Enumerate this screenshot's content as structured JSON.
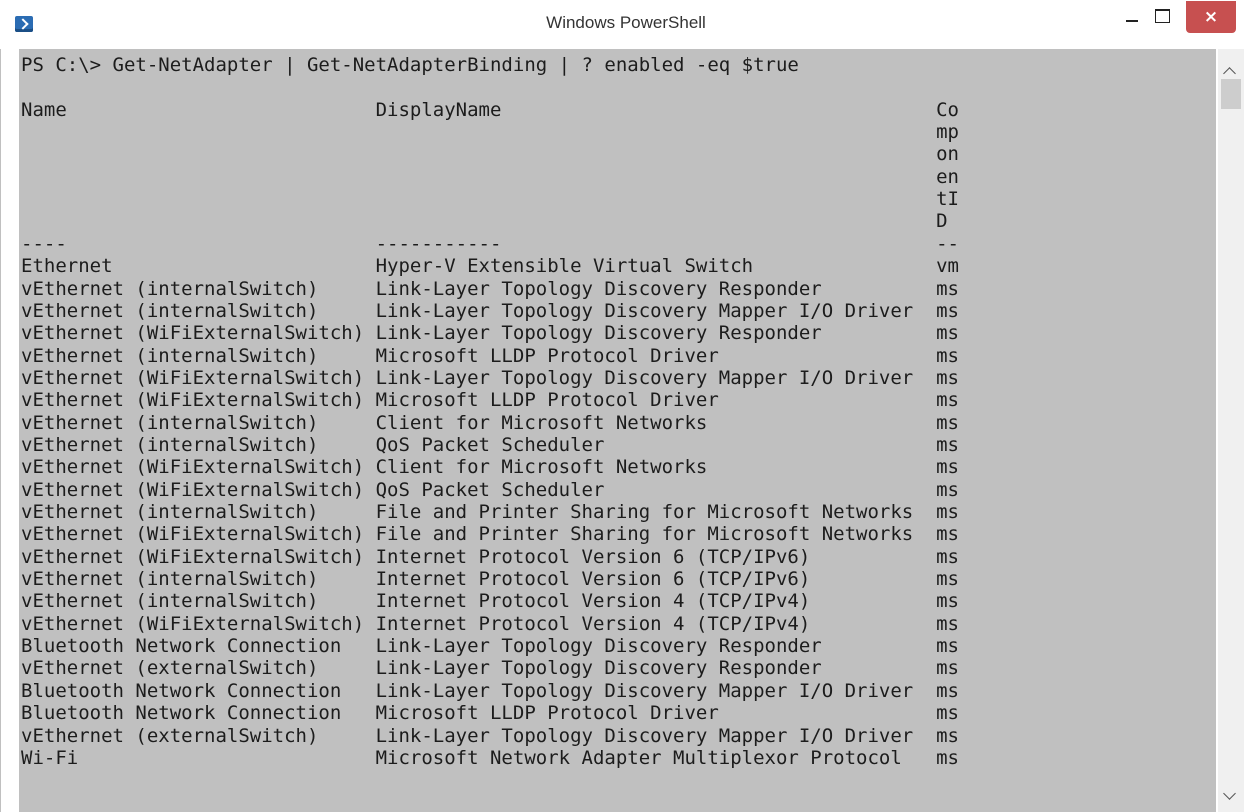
{
  "window": {
    "title": "Windows PowerShell",
    "icon": "powershell-icon",
    "buttons": {
      "minimize": "minimize-icon",
      "maximize": "maximize-icon",
      "close": "×"
    }
  },
  "console": {
    "command": "PS C:\\> Get-NetAdapter | Get-NetAdapterBinding | ? enabled -eq $true",
    "header": {
      "name": "Name",
      "display_name": "DisplayName",
      "component_id_wrapped": [
        "Co",
        "mp",
        "on",
        "en",
        "tI",
        "D"
      ]
    },
    "separator": {
      "name": "----",
      "display_name": "-----------",
      "component_id": "--"
    },
    "rows": [
      {
        "name": "Ethernet",
        "display_name": "Hyper-V Extensible Virtual Switch",
        "component_id": "vm"
      },
      {
        "name": "vEthernet (internalSwitch)",
        "display_name": "Link-Layer Topology Discovery Responder",
        "component_id": "ms"
      },
      {
        "name": "vEthernet (internalSwitch)",
        "display_name": "Link-Layer Topology Discovery Mapper I/O Driver",
        "component_id": "ms"
      },
      {
        "name": "vEthernet (WiFiExternalSwitch)",
        "display_name": "Link-Layer Topology Discovery Responder",
        "component_id": "ms"
      },
      {
        "name": "vEthernet (internalSwitch)",
        "display_name": "Microsoft LLDP Protocol Driver",
        "component_id": "ms"
      },
      {
        "name": "vEthernet (WiFiExternalSwitch)",
        "display_name": "Link-Layer Topology Discovery Mapper I/O Driver",
        "component_id": "ms"
      },
      {
        "name": "vEthernet (WiFiExternalSwitch)",
        "display_name": "Microsoft LLDP Protocol Driver",
        "component_id": "ms"
      },
      {
        "name": "vEthernet (internalSwitch)",
        "display_name": "Client for Microsoft Networks",
        "component_id": "ms"
      },
      {
        "name": "vEthernet (internalSwitch)",
        "display_name": "QoS Packet Scheduler",
        "component_id": "ms"
      },
      {
        "name": "vEthernet (WiFiExternalSwitch)",
        "display_name": "Client for Microsoft Networks",
        "component_id": "ms"
      },
      {
        "name": "vEthernet (WiFiExternalSwitch)",
        "display_name": "QoS Packet Scheduler",
        "component_id": "ms"
      },
      {
        "name": "vEthernet (internalSwitch)",
        "display_name": "File and Printer Sharing for Microsoft Networks",
        "component_id": "ms"
      },
      {
        "name": "vEthernet (WiFiExternalSwitch)",
        "display_name": "File and Printer Sharing for Microsoft Networks",
        "component_id": "ms"
      },
      {
        "name": "vEthernet (WiFiExternalSwitch)",
        "display_name": "Internet Protocol Version 6 (TCP/IPv6)",
        "component_id": "ms"
      },
      {
        "name": "vEthernet (internalSwitch)",
        "display_name": "Internet Protocol Version 6 (TCP/IPv6)",
        "component_id": "ms"
      },
      {
        "name": "vEthernet (internalSwitch)",
        "display_name": "Internet Protocol Version 4 (TCP/IPv4)",
        "component_id": "ms"
      },
      {
        "name": "vEthernet (WiFiExternalSwitch)",
        "display_name": "Internet Protocol Version 4 (TCP/IPv4)",
        "component_id": "ms"
      },
      {
        "name": "Bluetooth Network Connection",
        "display_name": "Link-Layer Topology Discovery Responder",
        "component_id": "ms"
      },
      {
        "name": "vEthernet (externalSwitch)",
        "display_name": "Link-Layer Topology Discovery Responder",
        "component_id": "ms"
      },
      {
        "name": "Bluetooth Network Connection",
        "display_name": "Link-Layer Topology Discovery Mapper I/O Driver",
        "component_id": "ms"
      },
      {
        "name": "Bluetooth Network Connection",
        "display_name": "Microsoft LLDP Protocol Driver",
        "component_id": "ms"
      },
      {
        "name": "vEthernet (externalSwitch)",
        "display_name": "Link-Layer Topology Discovery Mapper I/O Driver",
        "component_id": "ms"
      },
      {
        "name": "Wi-Fi",
        "display_name": "Microsoft Network Adapter Multiplexor Protocol",
        "component_id": "ms"
      }
    ]
  },
  "colors": {
    "console_bg": "#c0c0c0",
    "console_text": "#1c1c1c",
    "close_button": "#c75050"
  }
}
